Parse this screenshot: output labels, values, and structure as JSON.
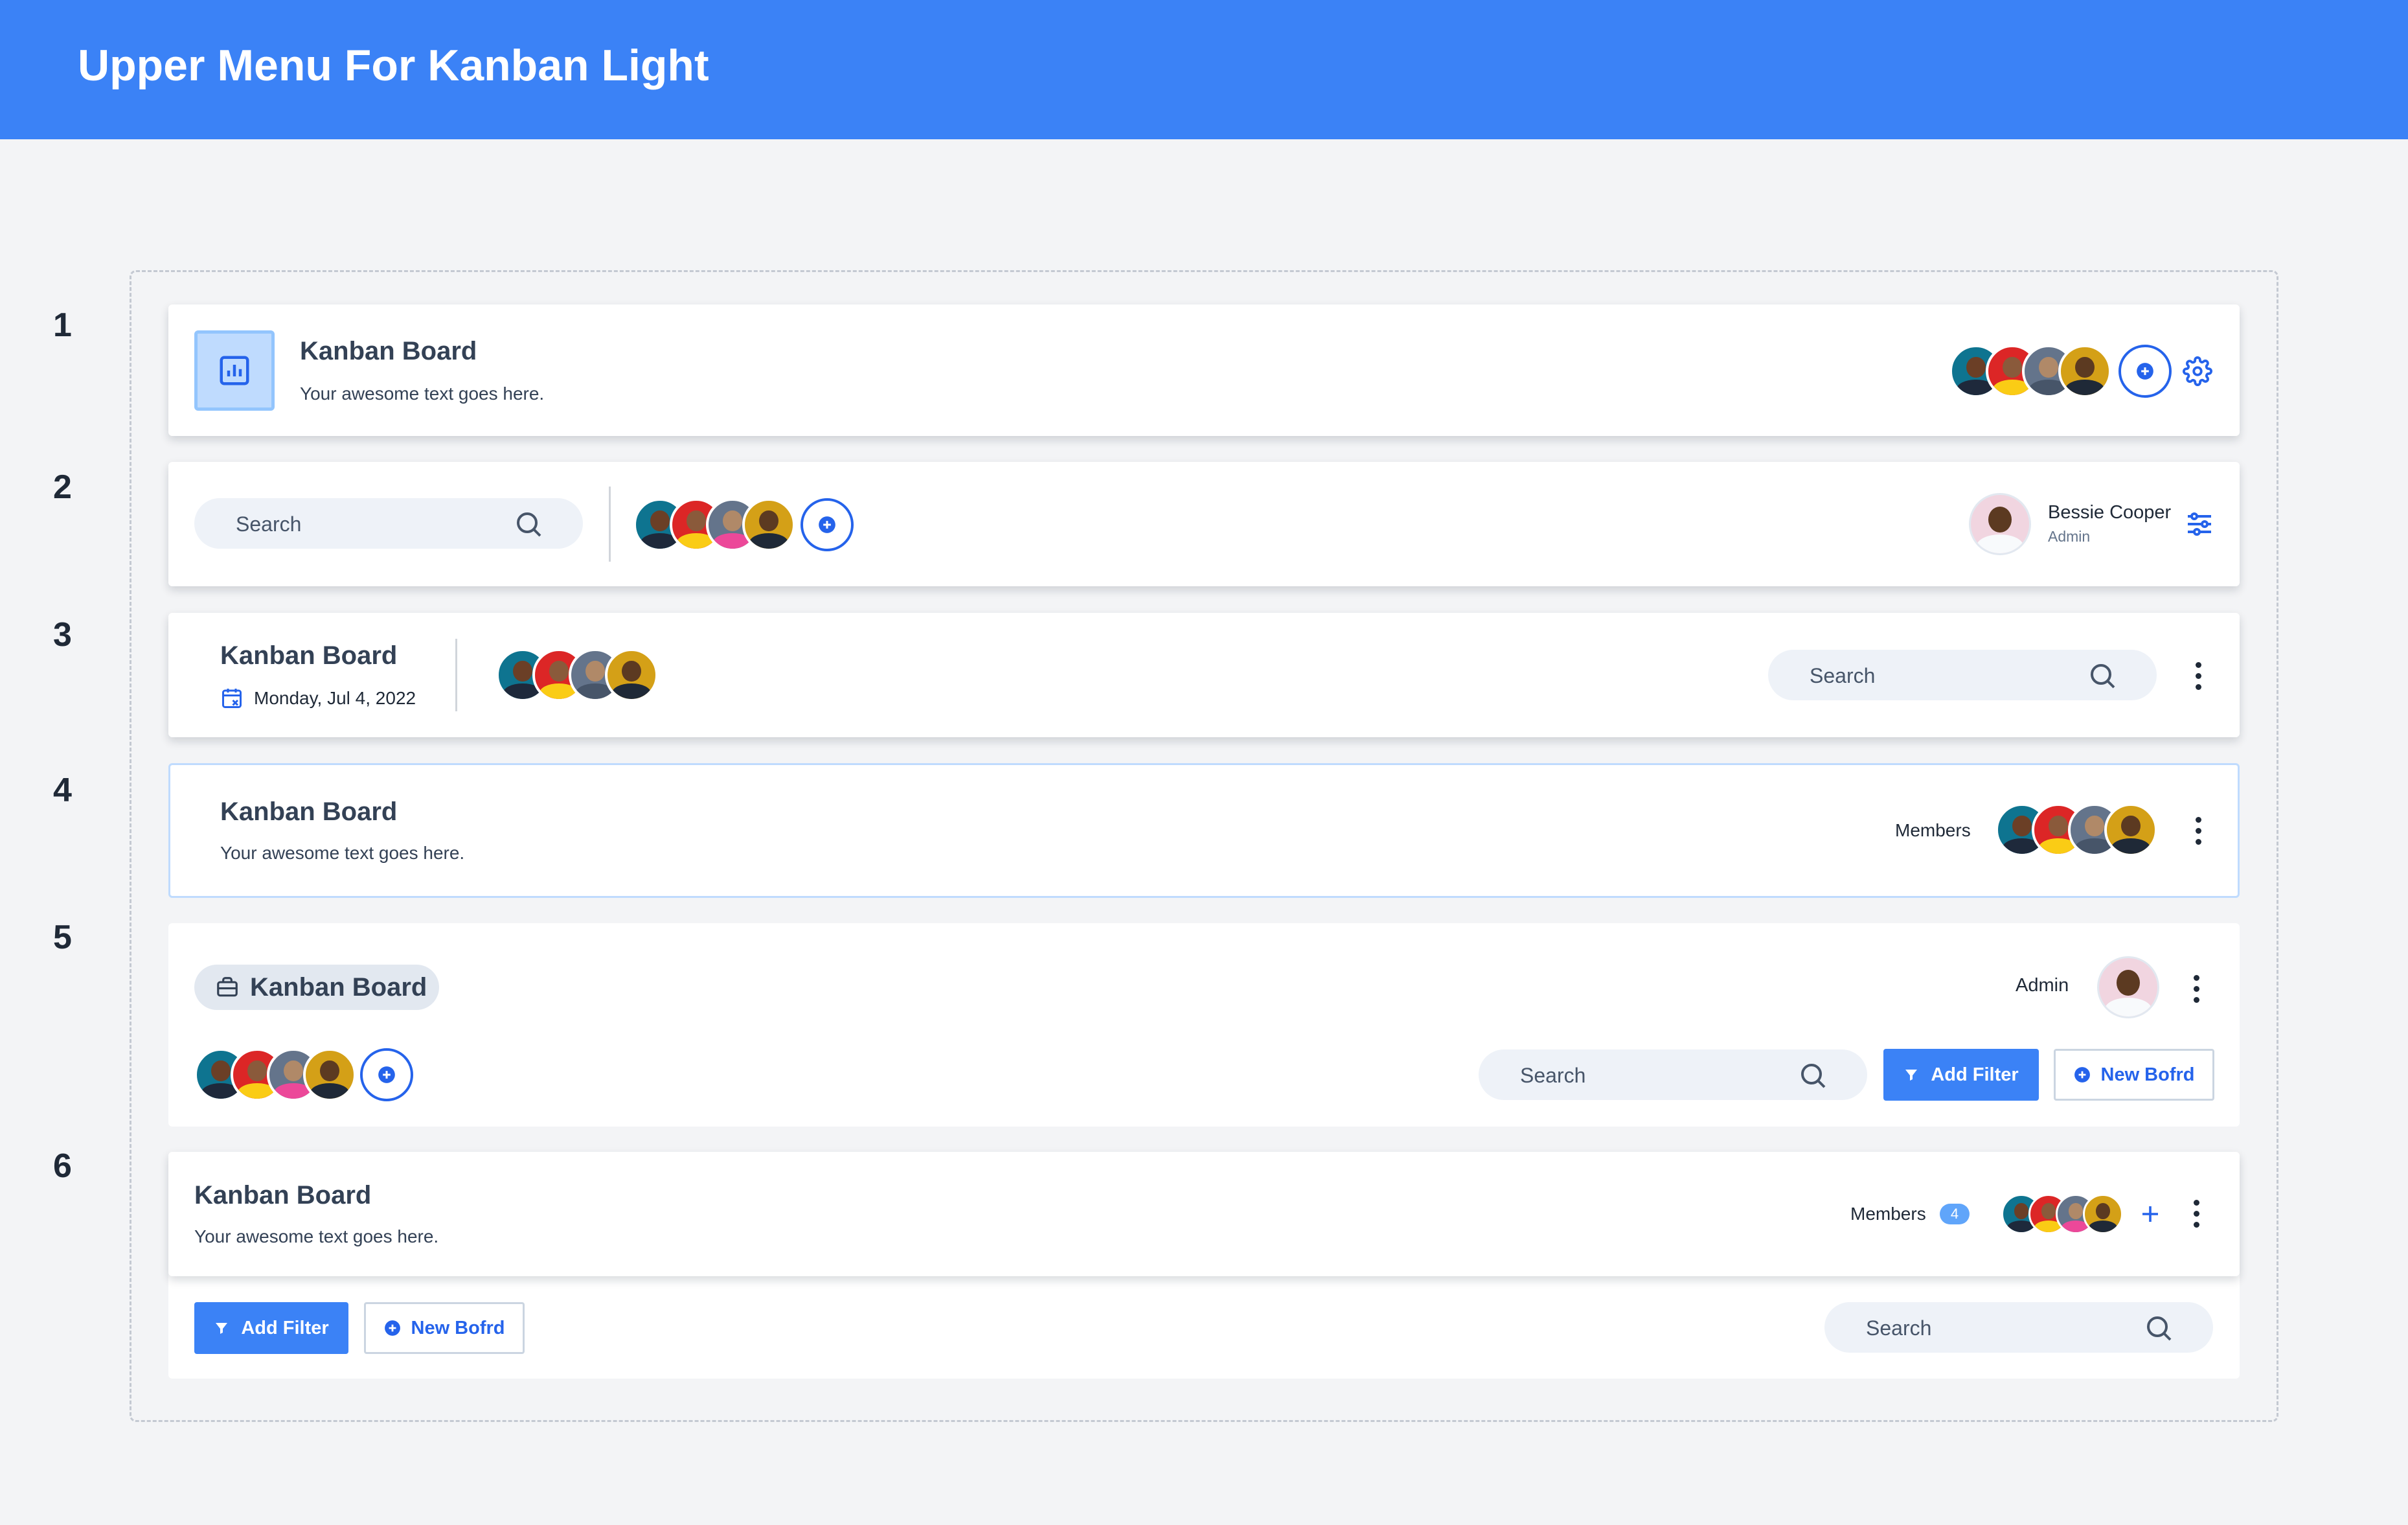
{
  "page": {
    "title": "Upper Menu For Kanban Light"
  },
  "labels": [
    "1",
    "2",
    "3",
    "4",
    "5",
    "6"
  ],
  "colors": {
    "accent": "#3b82f6",
    "accent_dark": "#2563eb",
    "background": "#f3f4f6",
    "card": "#ffffff"
  },
  "row1": {
    "title": "Kanban Board",
    "subtitle": "Your awesome text goes here.",
    "icon": "chart-bar-icon",
    "settings_icon": "gear-icon"
  },
  "row2": {
    "search_placeholder": "Search",
    "user_name": "Bessie Cooper",
    "user_role": "Admin",
    "filter_icon": "sliders-icon"
  },
  "row3": {
    "title": "Kanban Board",
    "date": "Monday, Jul 4, 2022",
    "search_placeholder": "Search"
  },
  "row4": {
    "title": "Kanban Board",
    "subtitle": "Your awesome text goes here.",
    "members_label": "Members"
  },
  "row5": {
    "title": "Kanban Board",
    "admin_label": "Admin",
    "search_placeholder": "Search",
    "add_filter": "Add Filter",
    "new_board": "New Bofrd"
  },
  "row6": {
    "title": "Kanban Board",
    "subtitle": "Your awesome text goes here.",
    "members_label": "Members",
    "members_count": "4",
    "add_filter": "Add Filter",
    "new_board": "New Bofrd",
    "search_placeholder": "Search"
  }
}
